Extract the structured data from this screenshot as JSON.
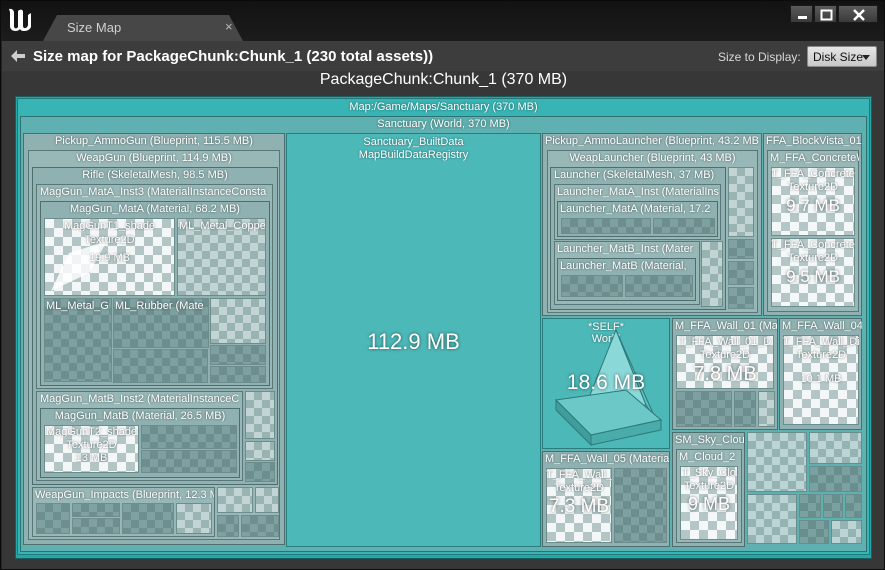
{
  "window": {
    "tab_label": "Size Map",
    "tab_close": "×"
  },
  "toolbar": {
    "title": "Size map for PackageChunk:Chunk_1  (230 total assets))",
    "size_to_display_label": "Size to Display:",
    "size_to_display_value": "Disk Size"
  },
  "package_title": "PackageChunk:Chunk_1  (370 MB)",
  "treemap": {
    "map": "Map:/Game/Maps/Sanctuary  (370 MB)",
    "world": "Sanctuary  (World, 370 MB)",
    "pickup_ammogun": "Pickup_AmmoGun  (Blueprint, 115.5 MB)",
    "weapgun": "WeapGun  (Blueprint, 114.9 MB)",
    "rifle": "Rifle  (SkeletalMesh, 98.5 MB)",
    "maggun_mata_inst3": "MagGun_MatA_Inst3  (MaterialInstanceConsta",
    "maggun_mata": "MagGun_MatA  (Material, 68.2 MB)",
    "maggunt1_name": "MagGunT1_shade",
    "maggunt1_type": "Texture2D",
    "maggunt1_size": "19.9 MB",
    "ml_metal_coppe": "ML_Metal_Coppe",
    "ml_metal_gr": "ML_Metal_Gr",
    "ml_rubber": "ML_Rubber  (Mate",
    "maggun_matb_inst2": "MagGun_MatB_Inst2  (MaterialInstanceC",
    "maggun_matb": "MagGun_MatB  (Material, 26.5 MB)",
    "maggunt2_name": "MagGunT2_shade",
    "maggunt2_type": "Texture2D",
    "maggunt2_size": "13 MB",
    "weapgun_impacts": "WeapGun_Impacts  (Blueprint, 12.3 M",
    "builtdata_name": "Sanctuary_BuiltData",
    "builtdata_type": "MapBuildDataRegistry",
    "builtdata_size": "112.9 MB",
    "pickup_ammolauncher": "Pickup_AmmoLauncher  (Blueprint, 43.2 MB",
    "weaplauncher": "WeapLauncher  (Blueprint, 43 MB)",
    "launcher": "Launcher  (SkeletalMesh, 37 MB)",
    "launcher_mata_inst": "Launcher_MatA_Inst  (MaterialIns",
    "launcher_mata": "Launcher_MatA  (Material, 17.2",
    "launcher_matb_inst": "Launcher_MatB_Inst  (Mater",
    "launcher_matb": "Launcher_MatB  (Material,",
    "ffa_blockvista": "FFA_BlockVista_01",
    "m_ffa_concrete_header": "M_FFA_ConcreteW",
    "t_ffa_concrete1_name": "T_FFA_Concrete",
    "t_ffa_concrete1_type": "Texture2D",
    "t_ffa_concrete1_size": "9.7 MB",
    "t_ffa_concrete2_name": "T_FFA_Concrete",
    "t_ffa_concrete2_type": "Texture2D",
    "t_ffa_concrete2_size": "9.5 MB",
    "self_name": "*SELF*",
    "self_type": "World",
    "self_size": "18.6 MB",
    "m_ffa_wall_01": "M_FFA_Wall_01  (Ma",
    "t_ffa_wall_01_name": "T_FFA_Wall_01_D",
    "t_ffa_wall_01_type": "Texture2D",
    "t_ffa_wall_01_size": "7.8 MB",
    "m_ffa_wall_04": "M_FFA_Wall_04",
    "t_ffa_wall_04_name": "T_FFA_Wall_Di",
    "t_ffa_wall_04_type": "Texture2D",
    "t_ffa_wall_04_size": "10.1 MB",
    "sm_sky_clou": "SM_Sky_Clou",
    "m_cloud_2": "M_Cloud_2",
    "t_sky_clo_name": "T_Sky_Clo",
    "t_sky_clo_type": "Texture2D",
    "t_sky_clo_size": "9 MB",
    "m_ffa_wall_05": "M_FFA_Wall_05  (Materia",
    "t_ffa_wall_05_name": "T_FFA_Wall_",
    "t_ffa_wall_05_type": "Texture2D",
    "t_ffa_wall_05_size": "7.3 MB"
  }
}
